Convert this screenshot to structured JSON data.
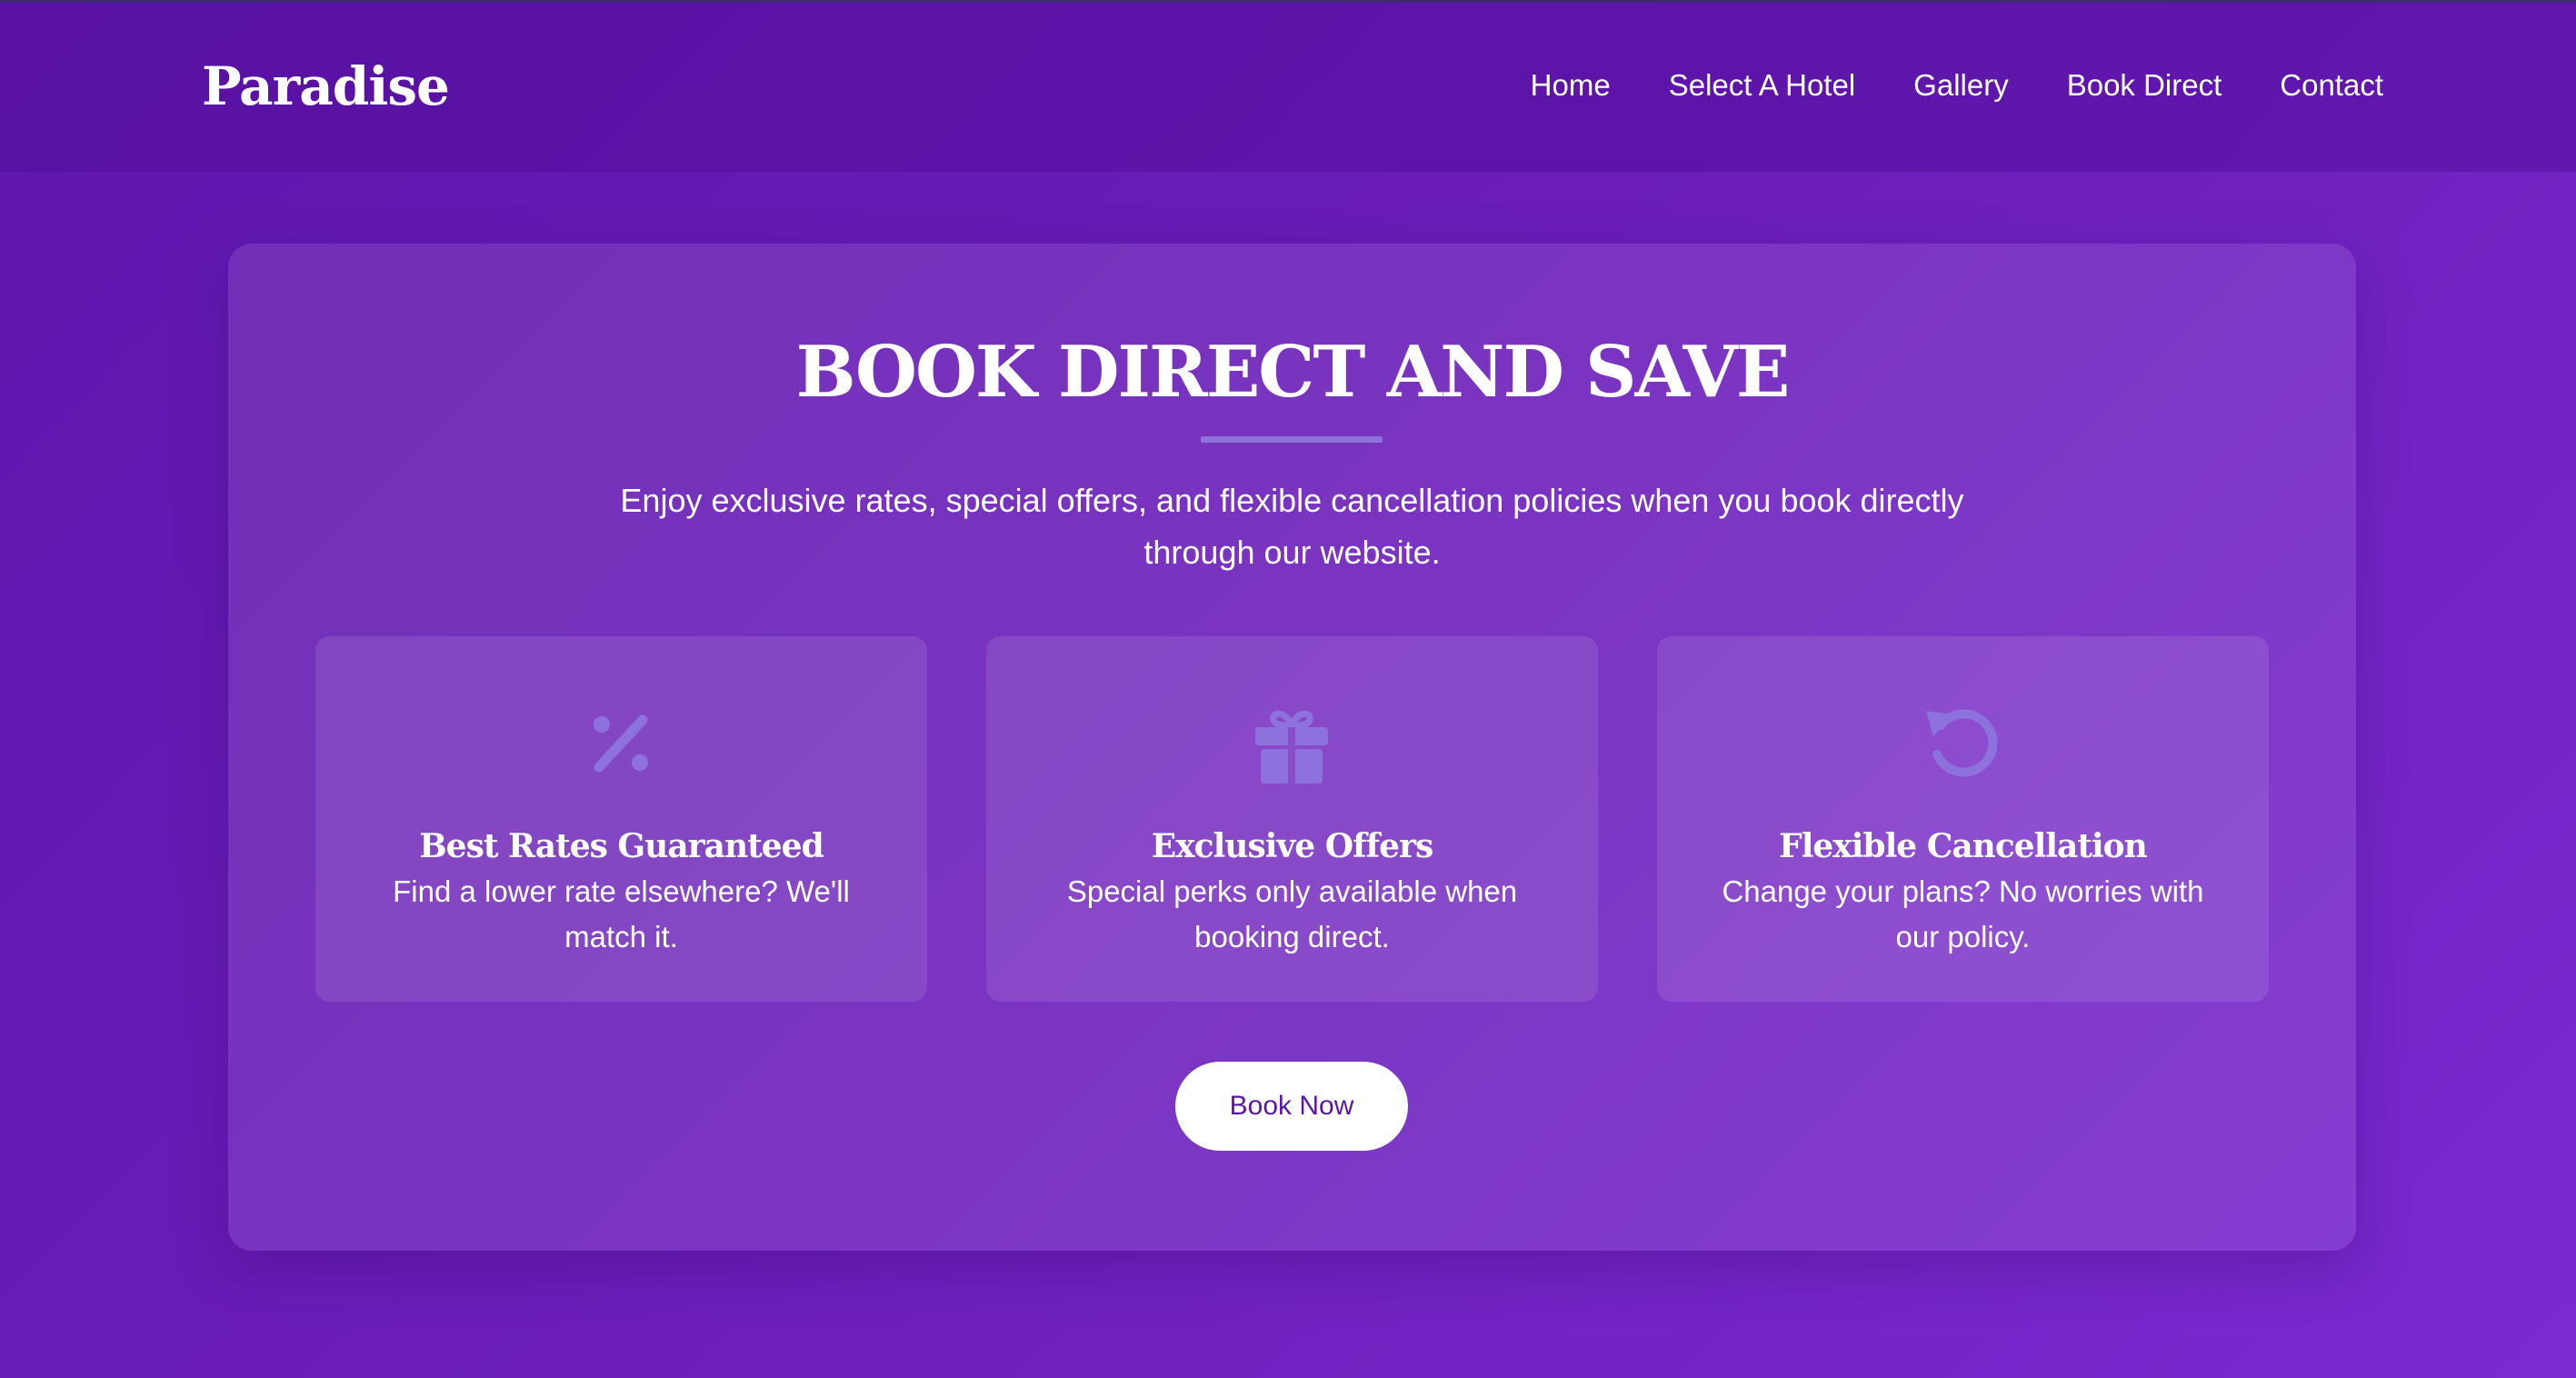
{
  "brand": "Paradise",
  "nav": {
    "items": [
      {
        "label": "Home"
      },
      {
        "label": "Select A Hotel"
      },
      {
        "label": "Gallery"
      },
      {
        "label": "Book Direct"
      },
      {
        "label": "Contact"
      }
    ]
  },
  "hero": {
    "title": "BOOK DIRECT AND SAVE",
    "subtitle": "Enjoy exclusive rates, special offers, and flexible cancellation policies when you book directly through our website.",
    "features": [
      {
        "icon": "percent-icon",
        "title": "Best Rates Guaranteed",
        "text": "Find a lower rate elsewhere? We'll match it."
      },
      {
        "icon": "gift-icon",
        "title": "Exclusive Offers",
        "text": "Special perks only available when booking direct."
      },
      {
        "icon": "undo-icon",
        "title": "Flexible Cancellation",
        "text": "Change your plans? No worries with our policy."
      }
    ],
    "button_label": "Book Now"
  },
  "colors": {
    "background": "#6a1db8",
    "icon": "#8d72de",
    "button_text": "#5a17a6"
  }
}
